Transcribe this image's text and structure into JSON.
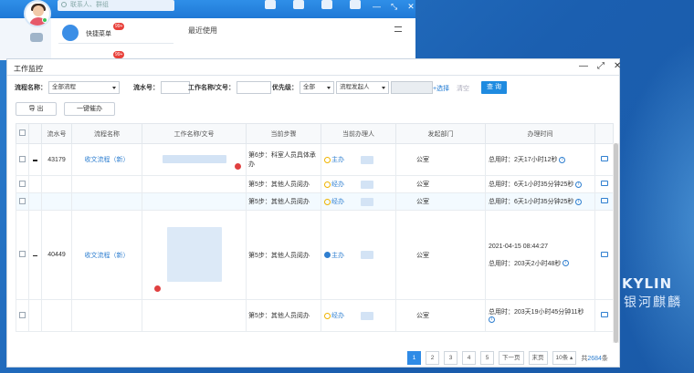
{
  "bg_app": {
    "search_placeholder": "联系人、群组",
    "quick_menu_label": "快捷菜单",
    "badge_1": "99+",
    "badge_2": "99+",
    "recent_label": "最近使用"
  },
  "dialog": {
    "title": "工作监控",
    "filters": {
      "flow_name_label": "流程名称：",
      "flow_name_value": "全部流程",
      "serial_label": "流水号：",
      "serial_value": "",
      "work_name_label": "工作名称/文号：",
      "work_name_value": "",
      "priority_label": "优先级：",
      "priority_value": "全部",
      "initiator_value": "流程发起人",
      "initiator_input": "",
      "pick_label": "+选择",
      "clear_label": "清空",
      "query_label": "查 询"
    },
    "actions": {
      "export_label": "导 出",
      "urge_label": "一键催办"
    },
    "table": {
      "headers": [
        "流水号",
        "流程名称",
        "工作名称/文号",
        "当前步骤",
        "当前办理人",
        "发起部门",
        "办理时间"
      ],
      "rows": [
        {
          "serial": "43179",
          "flow": "收文流程（新）",
          "step": "第6步：科室人员具体承办",
          "handler": "主办",
          "dept": "公室",
          "time_top": "",
          "time_total": "总用时：2天17小时12秒"
        },
        {
          "serial": "",
          "flow": "",
          "step": "第5步：其他人员阅办",
          "handler": "经办",
          "dept": "公室",
          "time_top": "",
          "time_total": "总用时：6天1小时35分钟25秒"
        },
        {
          "serial": "",
          "flow": "",
          "step": "第5步：其他人员阅办",
          "handler": "经办",
          "dept": "公室",
          "time_top": "",
          "time_total": "总用时：6天1小时35分钟25秒"
        },
        {
          "serial": "40449",
          "flow": "收文流程（新）",
          "step": "第5步：其他人员阅办",
          "handler": "主办",
          "dept": "公室",
          "time_top": "2021-04-15 08:44:27",
          "time_total": "总用时：203天2小时48秒"
        },
        {
          "serial": "",
          "flow": "",
          "step": "第5步：其他人员阅办",
          "handler": "经办",
          "dept": "公室",
          "time_top": "",
          "time_total": "总用时：203天19小时45分钟11秒"
        }
      ]
    },
    "pager": {
      "pages": [
        "1",
        "2",
        "3",
        "4",
        "5"
      ],
      "next": "下一页",
      "last": "末页",
      "page_size": "10条",
      "total_prefix": "共",
      "total_count": "2684",
      "total_suffix": "条"
    }
  },
  "brand": {
    "name": "KYLIN",
    "name_cn": "银河麒麟"
  }
}
